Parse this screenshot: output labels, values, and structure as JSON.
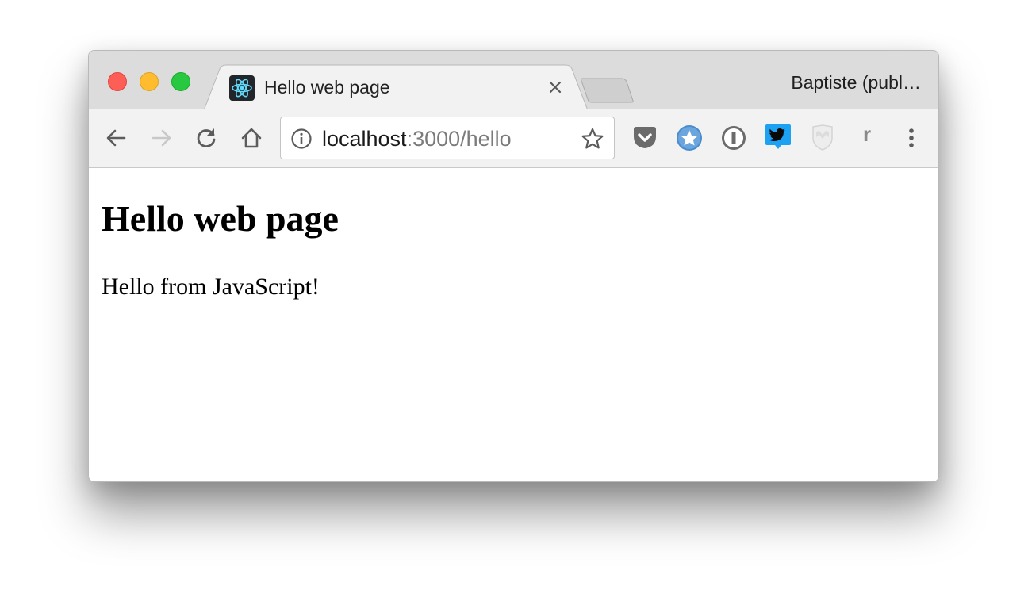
{
  "window": {
    "profile_name": "Baptiste (publ…",
    "traffic_lights": {
      "close": "#fd5f57",
      "minimize": "#febc2e",
      "maximize": "#28c840"
    }
  },
  "tabs": [
    {
      "title": "Hello web page",
      "favicon": "react-icon",
      "active": true
    }
  ],
  "toolbar": {
    "back": "back-arrow-icon",
    "forward": "forward-arrow-icon",
    "reload": "reload-icon",
    "home": "home-icon",
    "omnibox": {
      "url_host": "localhost",
      "url_rest": ":3000/hello",
      "info": "info-icon",
      "bookmark": "star-icon"
    },
    "extensions": [
      "pocket-icon",
      "bookmark-star-icon",
      "1password-icon",
      "twitter-icon",
      "shield-icon",
      "r-icon",
      "menu-icon"
    ],
    "r_ext_label": "r"
  },
  "page": {
    "heading": "Hello web page",
    "paragraph": "Hello from JavaScript!"
  },
  "colors": {
    "tabstrip_bg": "#dcdcdc",
    "toolbar_bg": "#f2f2f2",
    "react_cyan": "#61dafb",
    "twitter_blue": "#1da1f2"
  }
}
